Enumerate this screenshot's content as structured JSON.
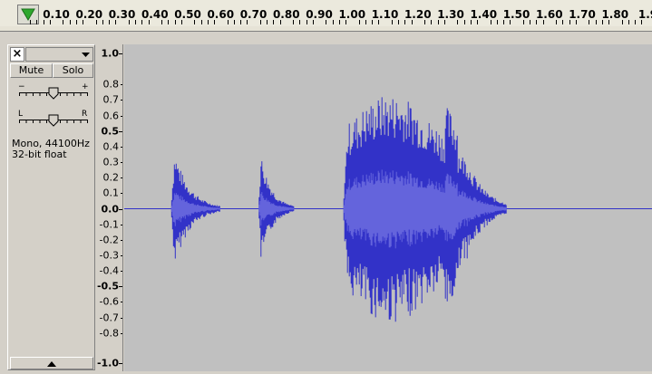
{
  "timeline": {
    "tick_labels": [
      "0.10",
      "0.20",
      "0.30",
      "0.40",
      "0.50",
      "0.60",
      "0.70",
      "0.80",
      "0.90",
      "1.00",
      "1.10",
      "1.20",
      "1.30",
      "1.40",
      "1.50",
      "1.60",
      "1.70",
      "1.80",
      "1.9"
    ],
    "play_head_color": "#2ea82e"
  },
  "track": {
    "mute_label": "Mute",
    "solo_label": "Solo",
    "gain_min": "−",
    "gain_max": "+",
    "pan_min": "L",
    "pan_max": "R",
    "format_line1": "Mono, 44100Hz",
    "format_line2": "32-bit float"
  },
  "amplitude_ruler": {
    "labels": [
      "1.0",
      "0.8",
      "0.7",
      "0.6",
      "0.5",
      "0.4",
      "0.3",
      "0.2",
      "0.1",
      "0.0",
      "-0.1",
      "-0.2",
      "-0.3",
      "-0.4",
      "-0.5",
      "-0.6",
      "-0.7",
      "-0.8",
      "-1.0"
    ],
    "bold_labels": [
      "1.0",
      "0.5",
      "0.0",
      "-0.5",
      "-1.0"
    ]
  },
  "waveform": {
    "color_outer": "#3232c8",
    "color_inner": "#6464dc",
    "background": "#c0c0c0",
    "time_range_s": [
      0.0,
      1.93
    ],
    "segments": [
      {
        "start_s": 0.17,
        "end_s": 0.35,
        "peak": 0.37
      },
      {
        "start_s": 0.49,
        "end_s": 0.62,
        "peak": 0.35
      },
      {
        "start_s": 0.8,
        "end_s": 1.4,
        "peak": 0.76
      }
    ]
  }
}
